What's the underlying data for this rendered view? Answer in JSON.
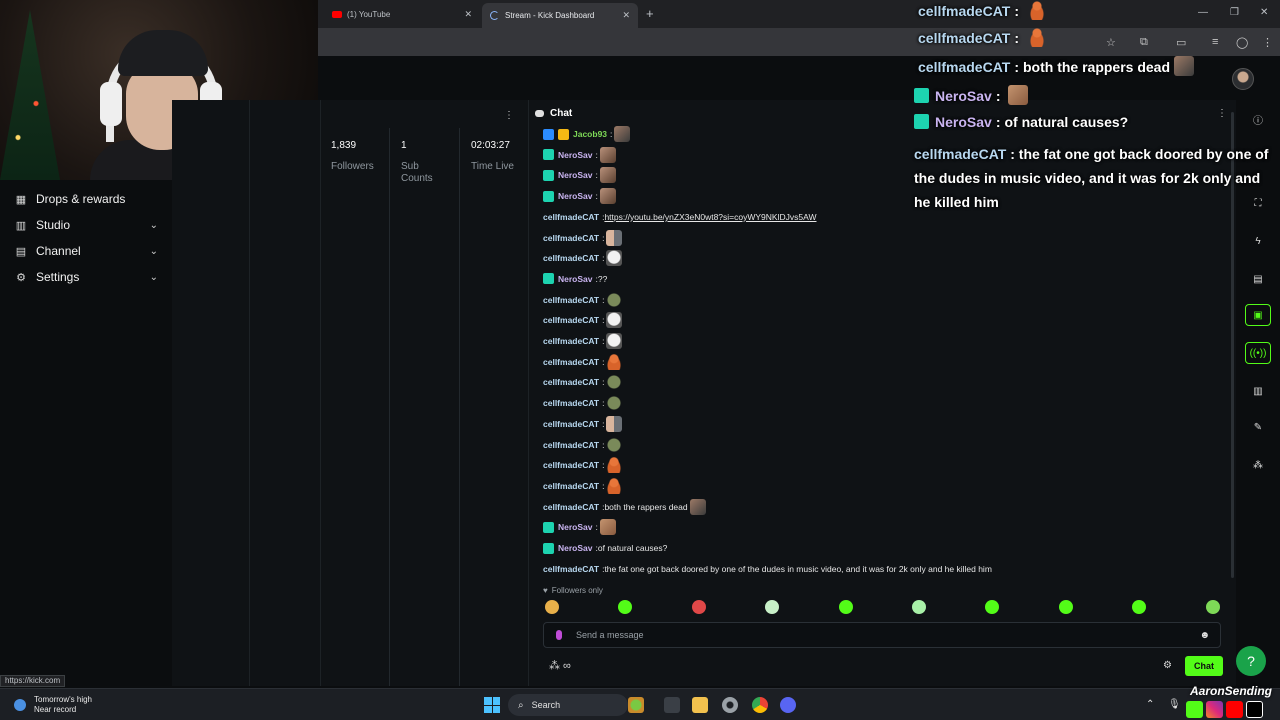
{
  "browser": {
    "tabs": [
      {
        "label": "(1) YouTube",
        "icon": "youtube-icon",
        "active": false
      },
      {
        "label": "Stream - Kick Dashboard",
        "icon": "loading-icon",
        "active": true
      }
    ],
    "status_url": "https://kick.com"
  },
  "sidebar": {
    "items": [
      {
        "label": "Drops & rewards",
        "icon": "gift-icon",
        "chevron": false
      },
      {
        "label": "Studio",
        "icon": "studio-icon",
        "chevron": true
      },
      {
        "label": "Channel",
        "icon": "channel-icon",
        "chevron": true
      },
      {
        "label": "Settings",
        "icon": "gear-icon",
        "chevron": true
      }
    ]
  },
  "stats": [
    {
      "value": "1,839",
      "label": "Followers"
    },
    {
      "value": "1",
      "label": "Sub Counts"
    },
    {
      "value": "02:03:27",
      "label": "Time Live"
    }
  ],
  "chat": {
    "title": "Chat",
    "messages": [
      {
        "user": "Jacob93",
        "badges": [
          "mod",
          "vip"
        ],
        "text": "",
        "emotes": [
          "e-man"
        ],
        "color": "#7ed957"
      },
      {
        "user": "NeroSav",
        "badges": [
          "sub"
        ],
        "text": "",
        "emotes": [
          "e-tear"
        ],
        "color": "#c9b4f0"
      },
      {
        "user": "NeroSav",
        "badges": [
          "sub"
        ],
        "text": "",
        "emotes": [
          "e-tear"
        ],
        "color": "#c9b4f0"
      },
      {
        "user": "NeroSav",
        "badges": [
          "sub"
        ],
        "text": "",
        "emotes": [
          "e-tear"
        ],
        "color": "#c9b4f0"
      },
      {
        "user": "cellfmadeCAT",
        "badges": [],
        "text": "",
        "link": "https://youtu.be/ynZX3eN0wt8?si=coyWY9NKlDJvs5AW",
        "emotes": [],
        "color": "#b8d8f0"
      },
      {
        "user": "cellfmadeCAT",
        "badges": [],
        "text": "",
        "emotes": [
          "e-meme"
        ],
        "color": "#b8d8f0"
      },
      {
        "user": "cellfmadeCAT",
        "badges": [],
        "text": "",
        "emotes": [
          "e-skull"
        ],
        "color": "#b8d8f0"
      },
      {
        "user": "NeroSav",
        "badges": [
          "sub"
        ],
        "text": "??",
        "emotes": [],
        "color": "#c9b4f0"
      },
      {
        "user": "cellfmadeCAT",
        "badges": [],
        "text": "",
        "emotes": [
          "e-frog"
        ],
        "color": "#b8d8f0"
      },
      {
        "user": "cellfmadeCAT",
        "badges": [],
        "text": "",
        "emotes": [
          "e-skull"
        ],
        "color": "#b8d8f0"
      },
      {
        "user": "cellfmadeCAT",
        "badges": [],
        "text": "",
        "emotes": [
          "e-skull"
        ],
        "color": "#b8d8f0"
      },
      {
        "user": "cellfmadeCAT",
        "badges": [],
        "text": "",
        "emotes": [
          "e-gingerbread"
        ],
        "color": "#b8d8f0"
      },
      {
        "user": "cellfmadeCAT",
        "badges": [],
        "text": "",
        "emotes": [
          "e-frog"
        ],
        "color": "#b8d8f0"
      },
      {
        "user": "cellfmadeCAT",
        "badges": [],
        "text": "",
        "emotes": [
          "e-frog"
        ],
        "color": "#b8d8f0"
      },
      {
        "user": "cellfmadeCAT",
        "badges": [],
        "text": "",
        "emotes": [
          "e-meme"
        ],
        "color": "#b8d8f0"
      },
      {
        "user": "cellfmadeCAT",
        "badges": [],
        "text": "",
        "emotes": [
          "e-frog"
        ],
        "color": "#b8d8f0"
      },
      {
        "user": "cellfmadeCAT",
        "badges": [],
        "text": "",
        "emotes": [
          "e-gingerbread"
        ],
        "color": "#b8d8f0"
      },
      {
        "user": "cellfmadeCAT",
        "badges": [],
        "text": "",
        "emotes": [
          "e-gingerbread"
        ],
        "color": "#b8d8f0"
      },
      {
        "user": "cellfmadeCAT",
        "badges": [],
        "text": "both the rappers dead",
        "emotes": [
          "e-man"
        ],
        "color": "#b8d8f0"
      },
      {
        "user": "NeroSav",
        "badges": [
          "sub"
        ],
        "text": "",
        "emotes": [
          "e-guy"
        ],
        "color": "#c9b4f0"
      },
      {
        "user": "NeroSav",
        "badges": [
          "sub"
        ],
        "text": "of natural causes?",
        "emotes": [],
        "color": "#c9b4f0"
      },
      {
        "user": "cellfmadeCAT",
        "badges": [],
        "text": "the fat one got back doored by one of the dudes in music video, and it was for 2k only and he killed him",
        "emotes": [],
        "color": "#b8d8f0"
      }
    ],
    "followers_only_label": "Followers only",
    "input_placeholder": "Send a message",
    "send_label": "Chat",
    "quick_emote_colors": [
      "#e8b04a",
      "#53fc18",
      "#e04848",
      "#c8f0c8",
      "#53fc18",
      "#a8f0a8",
      "#53fc18",
      "#53fc18",
      "#53fc18",
      "#7ed957"
    ]
  },
  "overlay": {
    "lines": [
      {
        "user": "cellfmadeCAT",
        "sep": ":",
        "text": "",
        "emote": "e-gingerbread",
        "badge": false
      },
      {
        "user": "cellfmadeCAT",
        "sep": ":",
        "text": "",
        "emote": "e-gingerbread",
        "badge": false
      },
      {
        "user": "cellfmadeCAT",
        "sep": ":",
        "text": "both the rappers dead",
        "emote": "e-man",
        "badge": false
      },
      {
        "user": "NeroSav",
        "sep": ":",
        "text": "",
        "emote": "e-guy",
        "badge": true
      },
      {
        "user": "NeroSav",
        "sep": ":",
        "text": "of natural causes?",
        "emote": "",
        "badge": true
      }
    ],
    "wrap_user": "cellfmadeCAT",
    "wrap_sep": ":",
    "wrap_text": "the fat one got back doored by one of the dudes in music video, and it was for 2k only and he killed him"
  },
  "taskbar": {
    "weather_title": "Tomorrow's high",
    "weather_sub": "Near record",
    "search_label": "Search"
  },
  "branding": {
    "name": "AaronSending"
  },
  "colors": {
    "kick_green": "#53fc18",
    "background": "#0b0d0f",
    "panel": "#0f1215"
  }
}
